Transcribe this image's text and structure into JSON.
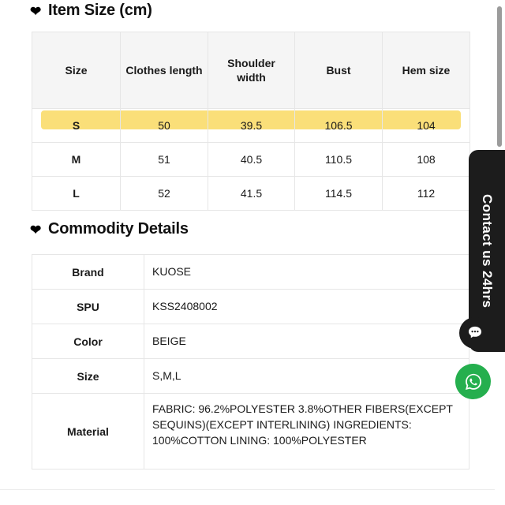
{
  "sections": {
    "item_size": {
      "heading": "Item Size (cm)",
      "bullet_icon": "heart-icon",
      "columns": [
        "Size",
        "Clothes length",
        "Shoulder width",
        "Bust",
        "Hem size"
      ],
      "rows": [
        {
          "size": "S",
          "clothes_length": "50",
          "shoulder_width": "39.5",
          "bust": "106.5",
          "hem_size": "104",
          "highlighted": true
        },
        {
          "size": "M",
          "clothes_length": "51",
          "shoulder_width": "40.5",
          "bust": "110.5",
          "hem_size": "108",
          "highlighted": false
        },
        {
          "size": "L",
          "clothes_length": "52",
          "shoulder_width": "41.5",
          "bust": "114.5",
          "hem_size": "112",
          "highlighted": false
        }
      ],
      "highlight_color": "#fadf79",
      "header_background": "#f5f5f5"
    },
    "commodity_details": {
      "heading": "Commodity Details",
      "bullet_icon": "heart-icon",
      "rows": [
        {
          "key": "Brand",
          "value": "KUOSE"
        },
        {
          "key": "SPU",
          "value": "KSS2408002"
        },
        {
          "key": "Color",
          "value": "BEIGE"
        },
        {
          "key": "Size",
          "value": "S,M,L"
        },
        {
          "key": "Material",
          "value": "FABRIC: 96.2%POLYESTER 3.8%OTHER FIBERS(EXCEPT SEQUINS)(EXCEPT INTERLINING) INGREDIENTS: 100%COTTON LINING: 100%POLYESTER"
        }
      ]
    }
  },
  "floating": {
    "contact_tab": {
      "label": "Contact us 24hrs",
      "background": "#1c1c1c",
      "chat_icon": "chat-bubble-icon"
    },
    "whatsapp": {
      "icon": "whatsapp-icon",
      "background": "#25af4e"
    }
  },
  "scrollbar": {
    "thumb_color": "#9b9b9b",
    "orientation": "vertical"
  }
}
